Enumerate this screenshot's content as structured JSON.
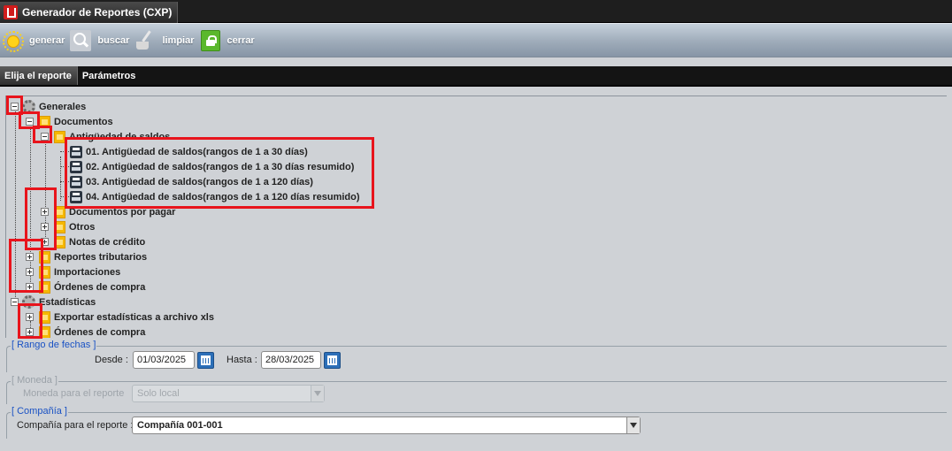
{
  "window": {
    "title": "Generador de Reportes (CXP)"
  },
  "toolbar": {
    "generate": "generar",
    "search": "buscar",
    "clear": "limpiar",
    "close": "cerrar"
  },
  "tabs": [
    "Elija el reporte",
    "Parámetros"
  ],
  "tree": {
    "generales": "Generales",
    "documentos": "Documentos",
    "antiguedad": "Antigüedad de saldos",
    "reports": [
      "01. Antigüedad de saldos(rangos de 1 a 30 días)",
      "02. Antigüedad de saldos(rangos de 1 a 30 días resumido)",
      "03. Antigüedad de saldos(rangos de 1 a 120 días)",
      "04. Antigüedad de saldos(rangos de 1 a 120 días resumido)"
    ],
    "documentos_por_pagar": "Documentos por pagar",
    "otros": "Otros",
    "notas_credito": "Notas de crédito",
    "reportes_tributarios": "Reportes tributarios",
    "importaciones": "Importaciones",
    "ordenes_compra": "Órdenes de compra",
    "estadisticas": "Estadísticas",
    "exportar_xls": "Exportar estadísticas a archivo xls",
    "ordenes_compra_2": "Órdenes de compra"
  },
  "date_range": {
    "legend": "[ Rango de fechas ]",
    "from_label": "Desde :",
    "from_value": "01/03/2025",
    "to_label": "Hasta :",
    "to_value": "28/03/2025"
  },
  "currency": {
    "legend": "[ Moneda ]",
    "label": "Moneda para el reporte",
    "value": "Solo local"
  },
  "company": {
    "legend": "[ Compañía ]",
    "label": "Compañía para el reporte :",
    "value": "Compañía 001-001"
  },
  "colors": {
    "highlight": "#e8141c",
    "legend_blue": "#1a52c4"
  }
}
